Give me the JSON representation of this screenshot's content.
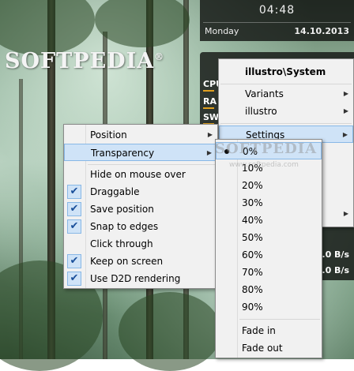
{
  "wallpaper": {
    "logo_text": "SOFTPEDIA",
    "logo_mark": "®"
  },
  "clock": {
    "time": "04:48",
    "day": "Monday",
    "date": "14.10.2013"
  },
  "system_widget": {
    "labels": [
      "CPU",
      "RA",
      "SW"
    ],
    "net_values": [
      "0.0 B/s",
      "0.0 B/s"
    ]
  },
  "skin_menu": {
    "title": "illustro\\System",
    "items": [
      {
        "label": "Variants",
        "submenu": true
      },
      {
        "label": "illustro",
        "submenu": true
      },
      {
        "label": "Settings",
        "submenu": true,
        "highlighted": true
      }
    ]
  },
  "settings_menu": {
    "items": [
      {
        "label": "Position",
        "submenu": true
      },
      {
        "label": "Transparency",
        "submenu": true,
        "highlighted": true
      },
      {
        "label": "Hide on mouse over",
        "checked": false
      },
      {
        "label": "Draggable",
        "checked": true
      },
      {
        "label": "Save position",
        "checked": true
      },
      {
        "label": "Snap to edges",
        "checked": true
      },
      {
        "label": "Click through",
        "checked": false
      },
      {
        "label": "Keep on screen",
        "checked": true
      },
      {
        "label": "Use D2D rendering",
        "checked": true
      }
    ]
  },
  "transparency_menu": {
    "items": [
      "0%",
      "10%",
      "20%",
      "30%",
      "40%",
      "50%",
      "60%",
      "70%",
      "80%",
      "90%"
    ],
    "selected": "0%",
    "fade_items": [
      "Fade in",
      "Fade out"
    ]
  },
  "watermark": {
    "text": "SOFTPEDIA",
    "sub": "www.softpedia.com"
  },
  "icons": {
    "submenu": "chevron-right-icon",
    "check": "checkmark-icon",
    "radio": "bullet-icon"
  },
  "colors": {
    "highlight_bg": "#cfe3f7",
    "highlight_border": "#88b8e6",
    "menu_bg": "#f1f1f1",
    "widget_bg": "#141614",
    "check_color": "#1a4f9a"
  }
}
